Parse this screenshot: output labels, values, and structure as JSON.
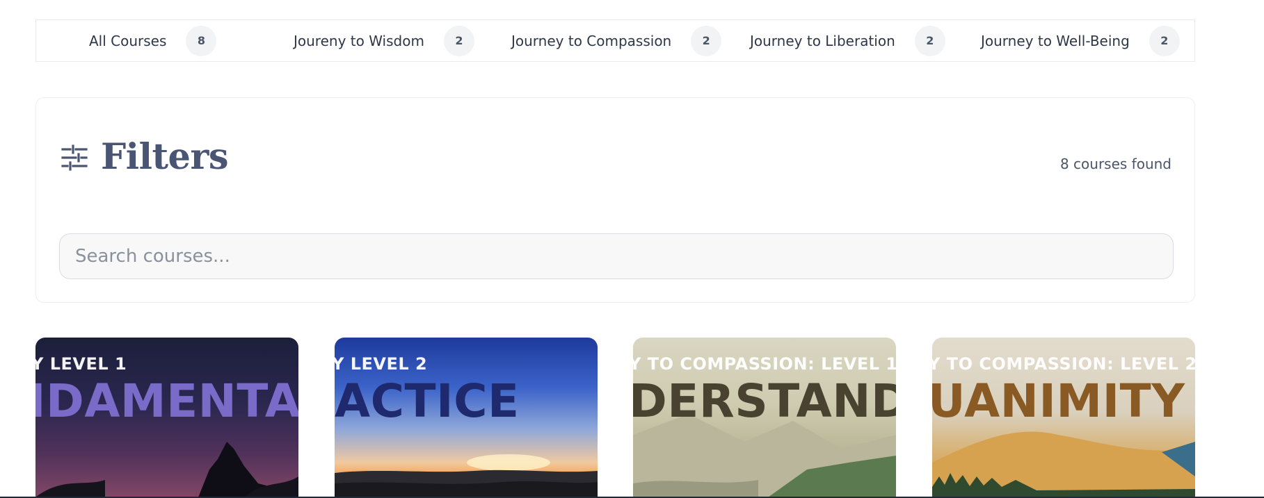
{
  "tabs": [
    {
      "label": "All Courses",
      "count": "8"
    },
    {
      "label": "Joureny to Wisdom",
      "count": "2"
    },
    {
      "label": "Journey to Compassion",
      "count": "2"
    },
    {
      "label": "Journey to Liberation",
      "count": "2"
    },
    {
      "label": "Journey to Well-Being",
      "count": "2"
    }
  ],
  "filters": {
    "title": "Filters",
    "icon": "sliders-icon",
    "count_text": "8 courses found",
    "search_placeholder": "Search courses..."
  },
  "courses": [
    {
      "subtitle": "Y LEVEL 1",
      "title": "IDAMENTALS"
    },
    {
      "subtitle": "Y LEVEL 2",
      "title": "ACTICE"
    },
    {
      "subtitle": "Y TO COMPASSION: LEVEL 1",
      "title": "DERSTANDING"
    },
    {
      "subtitle": "Y TO COMPASSION: LEVEL 2",
      "title": "UANIMITY"
    }
  ]
}
